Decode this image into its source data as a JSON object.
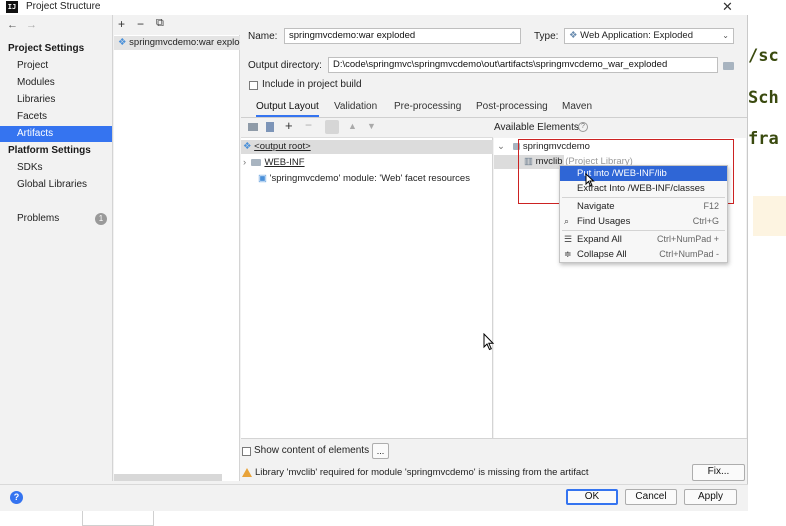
{
  "window": {
    "title": "Project Structure",
    "close_glyph": "✕",
    "app_icon": "intellij-icon",
    "logo_text": "IJ"
  },
  "nav": {
    "back": "←",
    "forward": "→",
    "section1": "Project Settings",
    "section1_items": [
      "Project",
      "Modules",
      "Libraries",
      "Facets",
      "Artifacts"
    ],
    "selected": "Artifacts",
    "section2": "Platform Settings",
    "section2_items": [
      "SDKs",
      "Global Libraries"
    ],
    "problems_label": "Problems",
    "problems_count": "1"
  },
  "artifacts": {
    "toolbar": {
      "add": "+",
      "remove": "−",
      "copy": "⧉"
    },
    "items": [
      "springmvcdemo:war exploded"
    ]
  },
  "detail": {
    "name_label": "Name:",
    "name_value": "springmvcdemo:war exploded",
    "type_label": "Type:",
    "type_value": "Web Application: Exploded",
    "output_dir_label": "Output directory:",
    "output_dir_value": "D:\\code\\springmvc\\springmvcdemo\\out\\artifacts\\springmvcdemo_war_exploded",
    "include_label": "Include in project build",
    "tabs": [
      "Output Layout",
      "Validation",
      "Pre-processing",
      "Post-processing",
      "Maven"
    ],
    "active_tab": "Output Layout"
  },
  "layout_tree": {
    "root": "<output root>",
    "items": [
      "WEB-INF",
      "'springmvcdemo' module: 'Web' facet resources"
    ]
  },
  "available": {
    "header": "Available Elements",
    "help_glyph": "?",
    "items": [
      "springmvcdemo",
      "mvclib",
      "(Project Library)"
    ]
  },
  "context_menu": {
    "items": [
      {
        "label": "Put into /WEB-INF/lib",
        "shortcut": ""
      },
      {
        "label": "Extract Into /WEB-INF/classes",
        "shortcut": ""
      },
      {
        "label": "Navigate",
        "shortcut": "F12"
      },
      {
        "label": "Find Usages",
        "shortcut": "Ctrl+G"
      },
      {
        "label": "Expand All",
        "shortcut": "Ctrl+NumPad +"
      },
      {
        "label": "Collapse All",
        "shortcut": "Ctrl+NumPad -"
      }
    ]
  },
  "bottom": {
    "show_content_label": "Show content of elements",
    "ellipsis": "...",
    "warning": "Library 'mvclib' required for module 'springmvcdemo' is missing from the artifact",
    "fix_label": "Fix..."
  },
  "footer": {
    "help": "?",
    "ok": "OK",
    "cancel": "Cancel",
    "apply": "Apply"
  },
  "background_code": [
    "/sc",
    "Sch",
    "fra"
  ],
  "colors": {
    "accent": "#3574f0",
    "selection": "#2f66d6",
    "warning": "#e8a33a",
    "highlight_box": "#cc2222"
  }
}
